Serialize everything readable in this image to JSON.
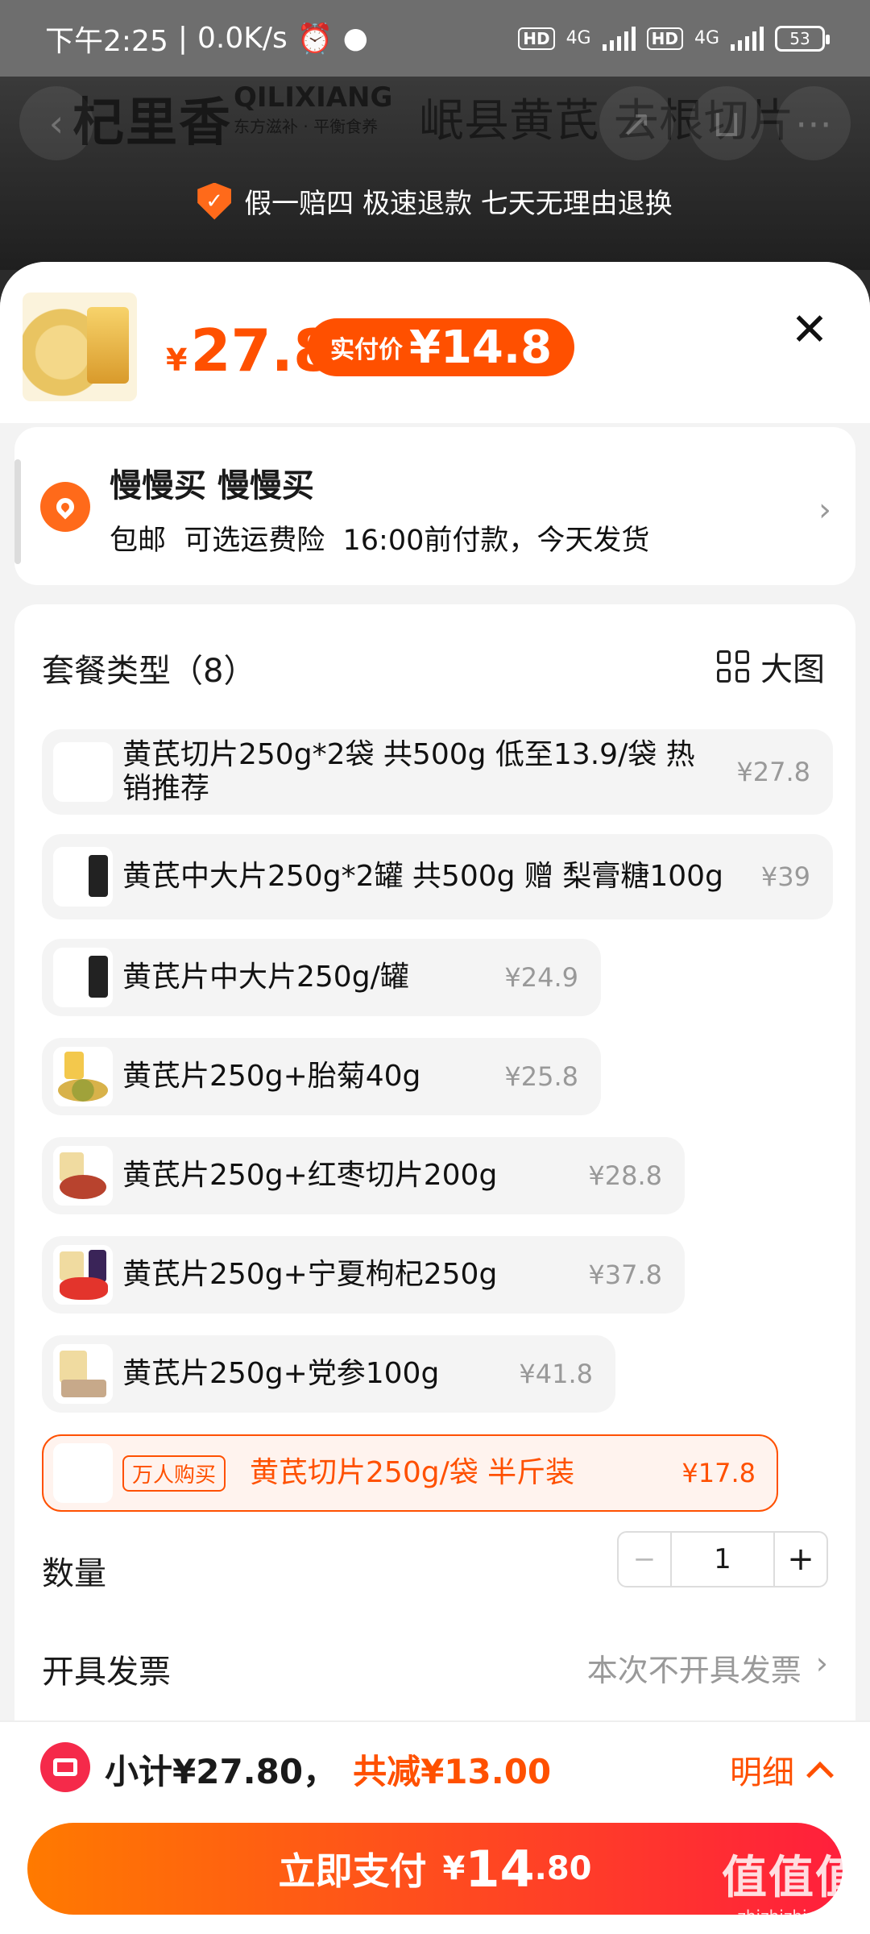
{
  "status_bar": {
    "time": "下午2:25",
    "speed": "0.0K/s",
    "net1": "4G",
    "net2": "4G",
    "hd": "HD",
    "battery": "53"
  },
  "header": {
    "brand_cn": "杞里香",
    "brand_latin": "QILIXIANG",
    "brand_slogan": "东方滋补 · 平衡食养",
    "title": "岷县黄芪 去根切片",
    "guarantee": "假一赔四  极速退款  七天无理由退换"
  },
  "sheet": {
    "price_currency": "¥",
    "price": "27.8",
    "pay_label": "实付价",
    "pay_price": "¥14.8"
  },
  "address": {
    "name": "慢慢买 慢慢买",
    "info": "包邮  可选运费险  16:00前付款，今天发货"
  },
  "options": {
    "title": "套餐类型（8）",
    "bigview": "大图",
    "items": [
      {
        "name": "黄芪切片250g*2袋 共500g 低至13.9/袋 热销推荐",
        "price": "¥27.8"
      },
      {
        "name": "黄芪中大片250g*2罐 共500g  赠 梨膏糖100g",
        "price": "¥39"
      },
      {
        "name": "黄芪片中大片250g/罐",
        "price": "¥24.9"
      },
      {
        "name": "黄芪片250g+胎菊40g",
        "price": "¥25.8"
      },
      {
        "name": "黄芪片250g+红枣切片200g",
        "price": "¥28.8"
      },
      {
        "name": "黄芪片250g+宁夏枸杞250g",
        "price": "¥37.8"
      },
      {
        "name": "黄芪片250g+党参100g",
        "price": "¥41.8"
      },
      {
        "badge": "万人购买",
        "name": "黄芪切片250g/袋 半斤装",
        "price": "¥17.8"
      }
    ]
  },
  "quantity": {
    "label": "数量",
    "minus": "−",
    "value": "1",
    "plus": "+"
  },
  "invoice": {
    "label": "开具发票",
    "value": "本次不开具发票"
  },
  "bottom": {
    "subtotal": "小计¥27.80，",
    "saving": "共减¥13.00",
    "detail": "明细",
    "pay_label": "立即支付",
    "pay_currency": "¥",
    "pay_int": "14",
    "pay_dec": ".80"
  },
  "watermark": {
    "main": "值值值",
    "sub": "zhizhizhi.com"
  },
  "colors": {
    "accent": "#ff5000",
    "red": "#ff1f3c"
  }
}
